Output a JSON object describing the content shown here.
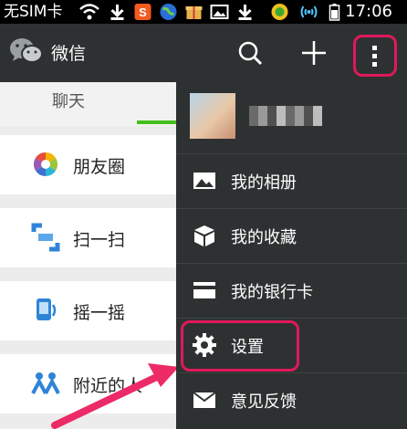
{
  "status_bar": {
    "carrier": "无SIM卡",
    "time": "17:06"
  },
  "title_bar": {
    "title": "微信"
  },
  "tabs": {
    "chat": "聊天"
  },
  "discover": {
    "items": [
      {
        "label": "朋友圈",
        "icon": "moments-icon"
      },
      {
        "label": "扫一扫",
        "icon": "scan-icon"
      },
      {
        "label": "摇一摇",
        "icon": "shake-icon"
      },
      {
        "label": "附近的人",
        "icon": "people-nearby-icon"
      }
    ]
  },
  "menu": {
    "items": [
      {
        "label": "我的相册",
        "icon": "album-icon"
      },
      {
        "label": "我的收藏",
        "icon": "favorites-icon"
      },
      {
        "label": "我的银行卡",
        "icon": "bank-card-icon"
      },
      {
        "label": "设置",
        "icon": "gear-icon"
      },
      {
        "label": "意见反馈",
        "icon": "feedback-icon"
      }
    ]
  },
  "colors": {
    "highlight": "#e0195b",
    "accent_green": "#45c01a",
    "bar": "#2e3132"
  }
}
